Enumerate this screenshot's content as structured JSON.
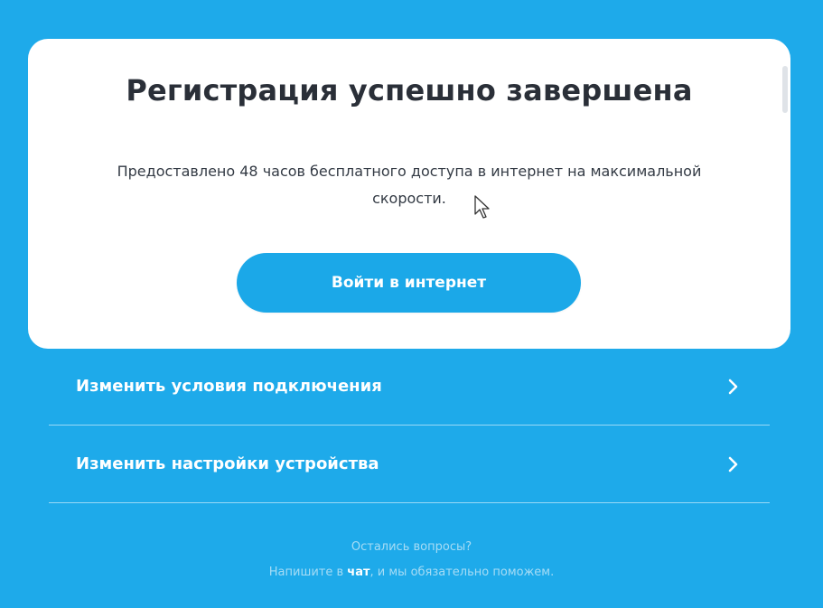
{
  "card": {
    "title": "Регистрация успешно завершена",
    "description_line1": "Предоставлено 48 часов бесплатного доступа в интернет на максимальной",
    "description_line2": "скорости.",
    "login_button_label": "Войти в интернет"
  },
  "menu": {
    "items": [
      {
        "label": "Изменить условия подключения",
        "icon": "chevron-right-icon"
      },
      {
        "label": "Изменить настройки устройства",
        "icon": "chevron-right-icon"
      }
    ]
  },
  "footer": {
    "question": "Остались вопросы?",
    "prefix": "Напишите в ",
    "chat_link": "чат",
    "suffix": ", и мы обязательно поможем."
  },
  "colors": {
    "background": "#1eaaea",
    "card": "#ffffff",
    "button": "#1ba8e8",
    "title_text": "#2a2f38",
    "footer_text": "#a6dcf5"
  }
}
